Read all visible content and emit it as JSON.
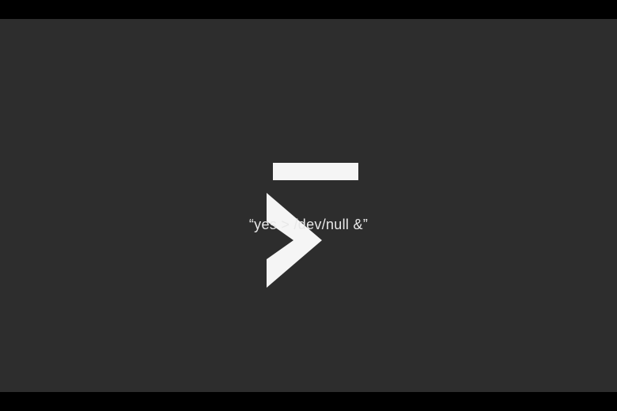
{
  "icon": {
    "name": "terminal-prompt-icon",
    "chevron_color": "#f5f5f5",
    "underscore_color": "#f5f5f5"
  },
  "caption": {
    "text": "“yes > /dev/null &”"
  },
  "colors": {
    "background": "#2d2d2d",
    "letterbox": "#000000",
    "foreground": "#f5f5f5",
    "caption": "#e8e8e8"
  }
}
